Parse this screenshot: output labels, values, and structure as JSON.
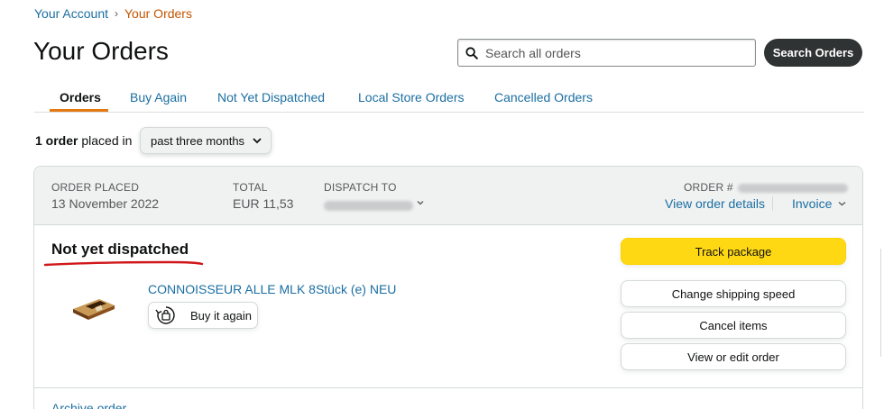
{
  "breadcrumb": {
    "parent": "Your Account",
    "separator": "›",
    "current": "Your Orders"
  },
  "page_title": "Your Orders",
  "search": {
    "placeholder": "Search all orders",
    "button_label": "Search Orders"
  },
  "tabs": [
    {
      "label": "Orders",
      "active": true
    },
    {
      "label": "Buy Again"
    },
    {
      "label": "Not Yet Dispatched"
    },
    {
      "label": "Local Store Orders"
    },
    {
      "label": "Cancelled Orders"
    }
  ],
  "filter": {
    "count_text": "1 order",
    "suffix": "placed in",
    "period": "past three months"
  },
  "order": {
    "placed_label": "ORDER PLACED",
    "placed_value": "13 November 2022",
    "total_label": "TOTAL",
    "total_value": "EUR 11,53",
    "dispatch_label": "DISPATCH TO",
    "order_number_label": "ORDER #",
    "view_details": "View order details",
    "invoice": "Invoice",
    "status": "Not yet dispatched",
    "product_title": "CONNOISSEUR ALLE MLK 8Stück (e) NEU",
    "buy_again": "Buy it again",
    "actions": {
      "track": "Track package",
      "change_speed": "Change shipping speed",
      "cancel": "Cancel items",
      "view_edit": "View or edit order"
    },
    "archive": "Archive order"
  },
  "colors": {
    "link": "#1b6ea1",
    "accent_orange": "#e47911",
    "track_button": "#ffd814",
    "annotation_red": "#d0181b"
  }
}
